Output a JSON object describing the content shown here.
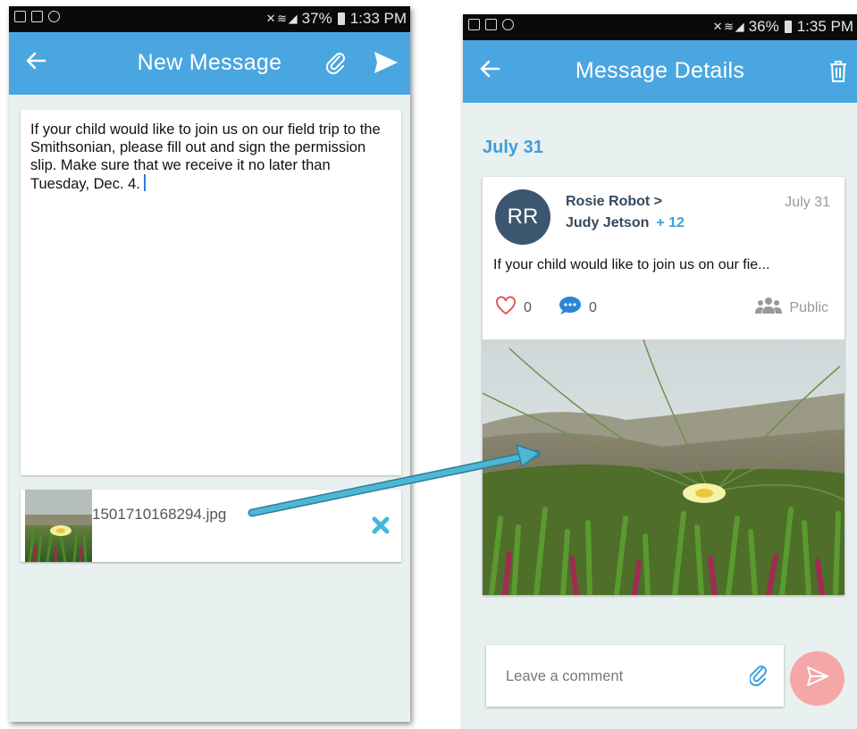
{
  "left_screen": {
    "status_bar": {
      "battery": "37%",
      "time": "1:33 PM"
    },
    "app_bar": {
      "back_icon": "arrow-left",
      "title": "New Message",
      "attach_icon": "paperclip",
      "send_icon": "send"
    },
    "compose": {
      "body": "If your child would like to join us on our field trip to the Smithsonian, please fill out and sign the permission slip. Make sure that we receive it no later than Tuesday, Dec. 4."
    },
    "attachment": {
      "filename": "1501710168294.jpg",
      "remove_icon": "close-x"
    }
  },
  "right_screen": {
    "status_bar": {
      "battery": "36%",
      "time": "1:35 PM"
    },
    "app_bar": {
      "back_icon": "arrow-left",
      "title": "Message Details",
      "delete_icon": "trash"
    },
    "date_heading": "July 31",
    "message": {
      "avatar_initials": "RR",
      "sender": "Rosie Robot >",
      "recipient": "Judy Jetson",
      "recipient_extra": "+ 12",
      "date": "July 31",
      "preview": "If your child would like to join us on our fie...",
      "likes": "0",
      "comments": "0",
      "visibility": "Public"
    },
    "comment": {
      "placeholder": "Leave a comment",
      "attach_icon": "paperclip",
      "send_icon": "send"
    }
  },
  "colors": {
    "app_bar": "#4aa6e0",
    "accent": "#3ba0dc",
    "avatar": "#3d5670",
    "like": "#e05a5a",
    "remove": "#45b8d8",
    "send_fab": "#f5a7a7",
    "connector_arrow": "#4db7d4"
  }
}
